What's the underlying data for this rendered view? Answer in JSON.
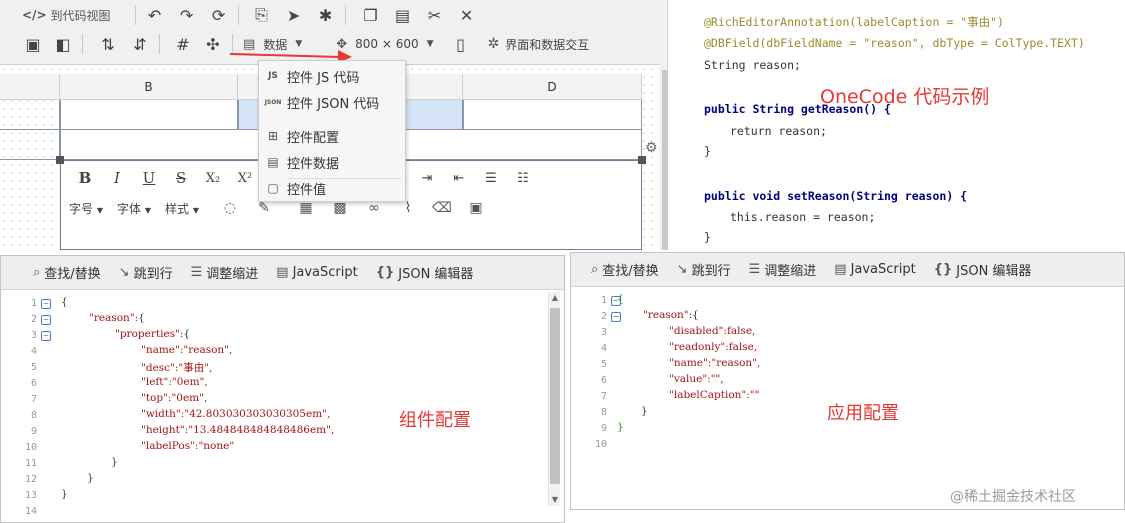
{
  "toolbar1": {
    "to_code_view": "到代码视图",
    "to_code_icon": "</>"
  },
  "toolbar2": {
    "data_menu_label": "数据",
    "canvas_size": "800 × 600",
    "ui_data_interaction": "界面和数据交互"
  },
  "grid": {
    "columns": [
      "",
      "B",
      "",
      "D"
    ]
  },
  "rich_editor": {
    "font_size_label": "字号",
    "font_family_label": "字体",
    "style_label": "样式"
  },
  "dropdown": {
    "items": [
      {
        "icon": "JS",
        "label": "控件 JS 代码"
      },
      {
        "icon": "JSON",
        "label": "控件 JSON 代码"
      },
      {
        "icon": "tree-icon",
        "label": "控件配置"
      },
      {
        "icon": "table-icon",
        "label": "控件数据"
      },
      {
        "icon": "value-icon",
        "label": "控件值"
      }
    ]
  },
  "code_sample": {
    "title": "OneCode 代码示例",
    "lines": [
      "@RichEditorAnnotation(labelCaption = \"事由\")",
      "@DBField(dbFieldName = \"reason\", dbType = ColType.TEXT)",
      "String reason;",
      "public String getReason() {",
      "return reason;",
      "}",
      "public void setReason(String reason) {",
      "this.reason = reason;",
      "}"
    ]
  },
  "editor_toolbar": {
    "find_replace": "查找/替换",
    "goto_line": "跳到行",
    "indent": "调整缩进",
    "javascript": "JavaScript",
    "json_editor": "JSON 编辑器"
  },
  "left_editor": {
    "caption": "组件配置",
    "line_numbers": [
      "1",
      "2",
      "3",
      "4",
      "5",
      "6",
      "7",
      "8",
      "9",
      "10",
      "11",
      "12",
      "13",
      "14"
    ],
    "name": "\"name\":\"reason\",",
    "desc": "\"desc\":\"事由\",",
    "left": "\"left\":\"0em\",",
    "top": "\"top\":\"0em\",",
    "width": "\"width\":\"42.803030303030305em\",",
    "height": "\"height\":\"13.484848484848486em\",",
    "labelPos": "\"labelPos\":\"none\""
  },
  "right_editor": {
    "caption": "应用配置",
    "line_numbers": [
      "1",
      "2",
      "3",
      "4",
      "5",
      "6",
      "7",
      "8",
      "9",
      "10"
    ],
    "disabled": "\"disabled\":false,",
    "readonly": "\"readonly\":false,",
    "name": "\"name\":\"reason\",",
    "value": "\"value\":\"\",",
    "labelCaption": "\"labelCaption\":\"\""
  },
  "watermark": "@稀土掘金技术社区",
  "colors": {
    "accent_red": "#e53935",
    "fold_blue": "#4a7cc7",
    "json_string": "#a31515"
  }
}
